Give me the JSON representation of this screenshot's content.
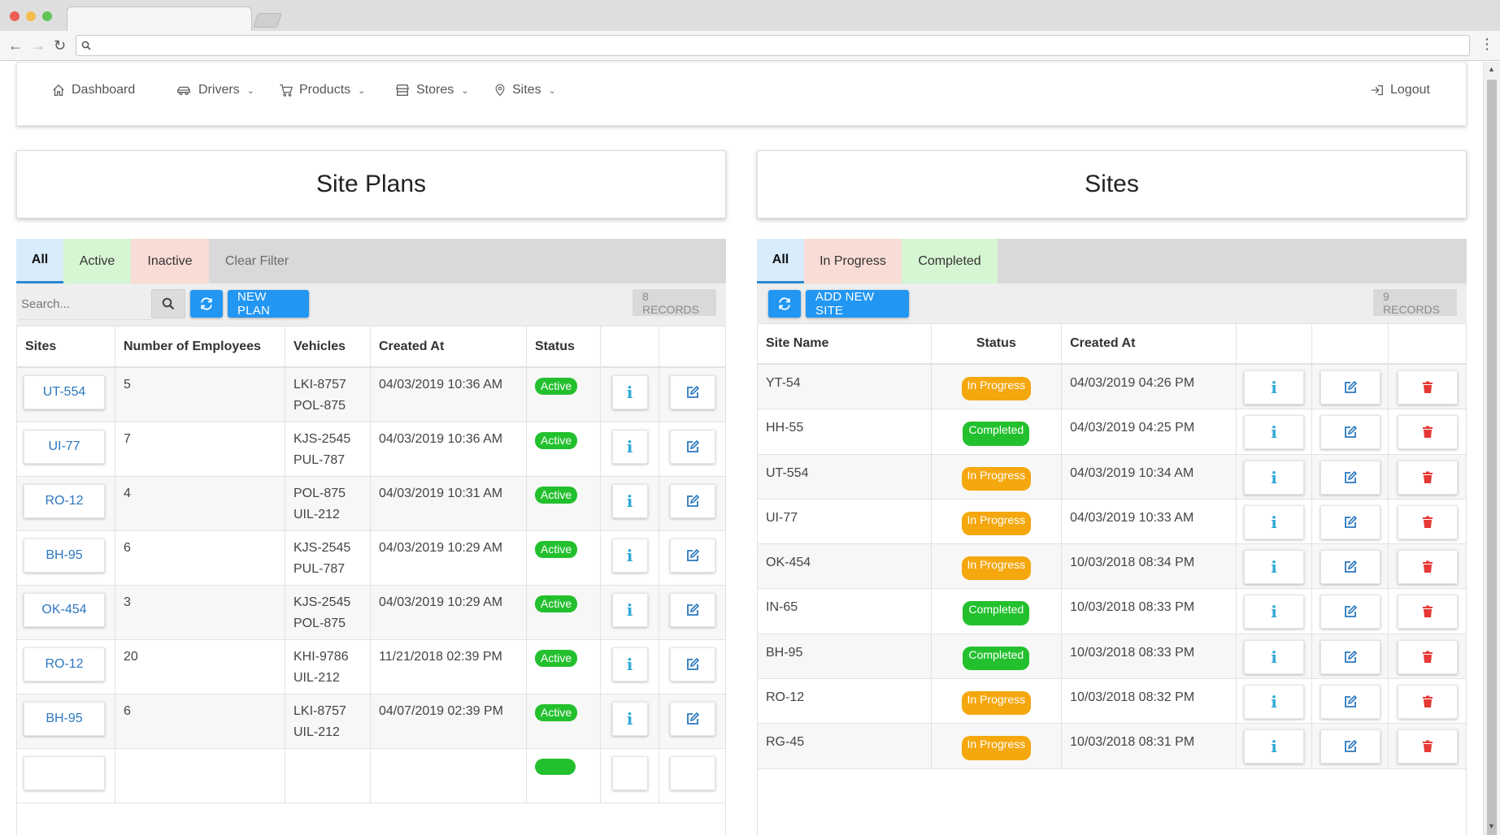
{
  "nav": {
    "dashboard": "Dashboard",
    "drivers": "Drivers",
    "products": "Products",
    "stores": "Stores",
    "sites": "Sites",
    "logout": "Logout"
  },
  "left_panel": {
    "title": "Site Plans",
    "filters": {
      "all": "All",
      "active": "Active",
      "inactive": "Inactive",
      "clear": "Clear Filter"
    },
    "search_placeholder": "Search...",
    "new_button": "NEW PLAN",
    "records": "8 RECORDS",
    "headers": {
      "sites": "Sites",
      "employees": "Number of Employees",
      "vehicles": "Vehicles",
      "created": "Created At",
      "status": "Status"
    },
    "rows": [
      {
        "site": "UT-554",
        "employees": "5",
        "vehicle1": "LKI-8757",
        "vehicle2": "POL-875",
        "created": "04/03/2019 10:36 AM",
        "status": "Active"
      },
      {
        "site": "UI-77",
        "employees": "7",
        "vehicle1": "KJS-2545",
        "vehicle2": "PUL-787",
        "created": "04/03/2019 10:36 AM",
        "status": "Active"
      },
      {
        "site": "RO-12",
        "employees": "4",
        "vehicle1": "POL-875",
        "vehicle2": "UIL-212",
        "created": "04/03/2019 10:31 AM",
        "status": "Active"
      },
      {
        "site": "BH-95",
        "employees": "6",
        "vehicle1": "KJS-2545",
        "vehicle2": "PUL-787",
        "created": "04/03/2019 10:29 AM",
        "status": "Active"
      },
      {
        "site": "OK-454",
        "employees": "3",
        "vehicle1": "KJS-2545",
        "vehicle2": "POL-875",
        "created": "04/03/2019 10:29 AM",
        "status": "Active"
      },
      {
        "site": "RO-12",
        "employees": "20",
        "vehicle1": "KHI-9786",
        "vehicle2": "UIL-212",
        "created": "11/21/2018 02:39 PM",
        "status": "Active"
      },
      {
        "site": "BH-95",
        "employees": "6",
        "vehicle1": "LKI-8757",
        "vehicle2": "UIL-212",
        "created": "04/07/2019 02:39 PM",
        "status": "Active"
      }
    ]
  },
  "right_panel": {
    "title": "Sites",
    "filters": {
      "all": "All",
      "in_progress": "In Progress",
      "completed": "Completed"
    },
    "new_button": "ADD NEW SITE",
    "records": "9 RECORDS",
    "headers": {
      "name": "Site Name",
      "status": "Status",
      "created": "Created At"
    },
    "rows": [
      {
        "name": "YT-54",
        "status": "In Progress",
        "created": "04/03/2019 04:26 PM"
      },
      {
        "name": "HH-55",
        "status": "Completed",
        "created": "04/03/2019 04:25 PM"
      },
      {
        "name": "UT-554",
        "status": "In Progress",
        "created": "04/03/2019 10:34 AM"
      },
      {
        "name": "UI-77",
        "status": "In Progress",
        "created": "04/03/2019 10:33 AM"
      },
      {
        "name": "OK-454",
        "status": "In Progress",
        "created": "10/03/2018 08:34 PM"
      },
      {
        "name": "IN-65",
        "status": "Completed",
        "created": "10/03/2018 08:33 PM"
      },
      {
        "name": "BH-95",
        "status": "Completed",
        "created": "10/03/2018 08:33 PM"
      },
      {
        "name": "RO-12",
        "status": "In Progress",
        "created": "10/03/2018 08:32 PM"
      },
      {
        "name": "RG-45",
        "status": "In Progress",
        "created": "10/03/2018 08:31 PM"
      }
    ]
  },
  "colors": {
    "primary": "#2196f3",
    "active_green": "#23c02e",
    "in_progress_orange": "#f5a70e",
    "delete_red": "#e53935",
    "info_blue": "#31a9d8",
    "link_blue": "#2b78c0"
  },
  "icons": {
    "dashboard": "home-icon",
    "drivers": "car-icon",
    "products": "cart-icon",
    "stores": "store-icon",
    "sites": "map-pin-icon",
    "logout": "sign-out-icon",
    "info": "info-icon",
    "edit": "edit-icon",
    "delete": "trash-icon",
    "refresh": "refresh-icon",
    "search": "search-icon"
  }
}
